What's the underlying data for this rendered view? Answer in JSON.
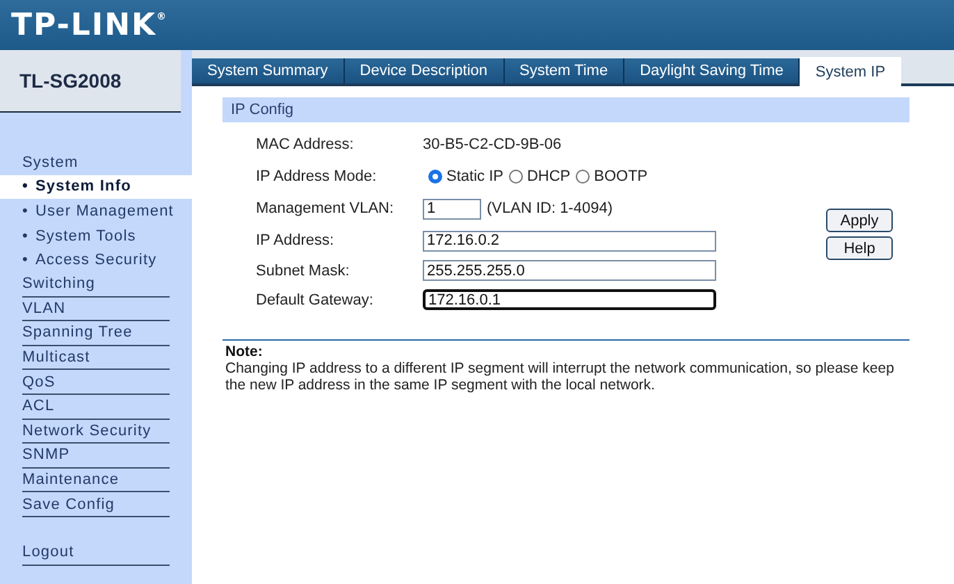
{
  "header": {
    "logo": "TP-LINK",
    "logo_mark": "®"
  },
  "sidebar": {
    "model": "TL-SG2008",
    "items": [
      {
        "label": "System",
        "kind": "heading",
        "selected": false
      },
      {
        "label": "System Info",
        "bullet": "•",
        "kind": "sub",
        "selected": true
      },
      {
        "label": "User Management",
        "bullet": "•",
        "kind": "sub",
        "selected": false
      },
      {
        "label": "System Tools",
        "bullet": "•",
        "kind": "sub",
        "selected": false
      },
      {
        "label": "Access Security",
        "bullet": "•",
        "kind": "sub",
        "selected": false
      },
      {
        "label": "Switching",
        "kind": "section",
        "selected": false
      },
      {
        "label": "VLAN",
        "kind": "section",
        "selected": false
      },
      {
        "label": "Spanning Tree",
        "kind": "section",
        "selected": false
      },
      {
        "label": "Multicast",
        "kind": "section",
        "selected": false
      },
      {
        "label": "QoS",
        "kind": "section",
        "selected": false
      },
      {
        "label": "ACL",
        "kind": "section",
        "selected": false
      },
      {
        "label": "Network Security",
        "kind": "section",
        "selected": false
      },
      {
        "label": "SNMP",
        "kind": "section",
        "selected": false
      },
      {
        "label": "Maintenance",
        "kind": "section",
        "selected": false
      },
      {
        "label": "Save Config",
        "kind": "section",
        "selected": false
      },
      {
        "label": "Logout",
        "kind": "logout",
        "selected": false
      }
    ]
  },
  "tabs": [
    {
      "label": "System Summary",
      "selected": false
    },
    {
      "label": "Device Description",
      "selected": false
    },
    {
      "label": "System Time",
      "selected": false
    },
    {
      "label": "Daylight Saving Time",
      "selected": false
    },
    {
      "label": "System IP",
      "selected": true
    }
  ],
  "panel": {
    "title": "IP Config",
    "rows": [
      {
        "kind": "text",
        "label": "MAC Address:",
        "value": "30-B5-C2-CD-9B-06"
      },
      {
        "kind": "radio",
        "label": "IP Address Mode:",
        "options": [
          {
            "label": "Static IP",
            "selected": true
          },
          {
            "label": "DHCP",
            "selected": false
          },
          {
            "label": "BOOTP",
            "selected": false
          }
        ]
      },
      {
        "kind": "short",
        "label": "Management VLAN:",
        "value": "1",
        "hint": "(VLAN ID: 1-4094)",
        "focused": false
      },
      {
        "kind": "input",
        "label": "IP Address:",
        "value": "172.16.0.2",
        "focused": false
      },
      {
        "kind": "input",
        "label": "Subnet Mask:",
        "value": "255.255.255.0",
        "focused": false
      },
      {
        "kind": "input",
        "label": "Default Gateway:",
        "value": "172.16.0.1",
        "focused": true
      }
    ],
    "buttons": [
      "Apply",
      "Help"
    ]
  },
  "note": {
    "title": "Note:",
    "text": "Changing IP address to a different IP segment will interrupt the network communication, so please keep the new IP address in the same IP segment with the local network."
  }
}
